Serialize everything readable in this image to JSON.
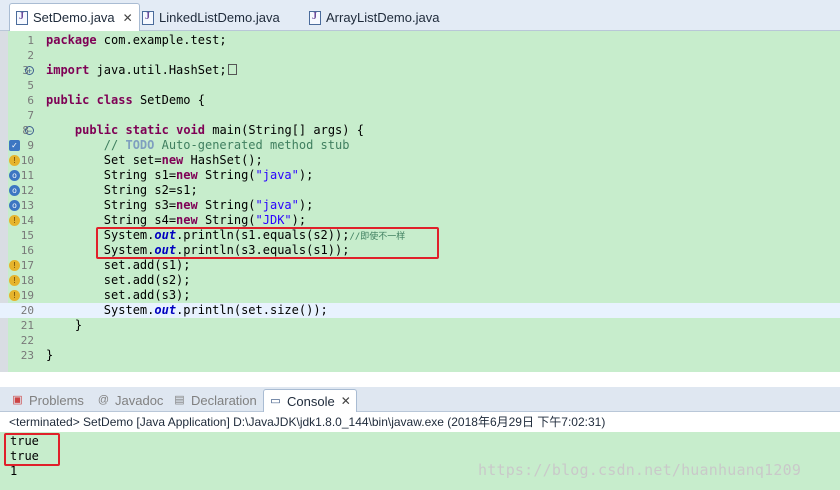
{
  "editor_tabs": [
    {
      "label": "SetDemo.java",
      "active": true
    },
    {
      "label": "LinkedListDemo.java",
      "active": false
    },
    {
      "label": "ArrayListDemo.java",
      "active": false
    }
  ],
  "close_glyph": "✕",
  "line_numbers": [
    "1",
    "2",
    "3",
    "5",
    "6",
    "7",
    "8",
    "9",
    "10",
    "11",
    "12",
    "13",
    "14",
    "15",
    "16",
    "17",
    "18",
    "19",
    "20",
    "21",
    "22",
    "23"
  ],
  "code": {
    "l1_kw": "package",
    "l1_rest": " com.example.test;",
    "l3_kw": "import",
    "l3_rest": " java.util.HashSet;",
    "l6_kw1": "public",
    "l6_kw2": "class",
    "l6_rest": " SetDemo {",
    "l8_kw1": "public",
    "l8_kw2": "static",
    "l8_kw3": "void",
    "l8_rest": " main(String[] args) {",
    "l9_cmt1": "// ",
    "l9_todo": "TODO",
    "l9_cmt2": " Auto-generated method stub",
    "l10_a": "Set set=",
    "l10_kw": "new",
    "l10_b": " HashSet();",
    "l11_a": "String s1=",
    "l11_kw": "new",
    "l11_b": " String(",
    "l11_str": "\"java\"",
    "l11_c": ");",
    "l12_a": "String s2=s1;",
    "l13_a": "String s3=",
    "l13_kw": "new",
    "l13_b": " String(",
    "l13_str": "\"java\"",
    "l13_c": ");",
    "l14_a": "String s4=",
    "l14_kw": "new",
    "l14_b": " String(",
    "l14_str": "\"JDK\"",
    "l14_c": ");",
    "l15_a": "System.",
    "l15_fld": "out",
    "l15_b": ".println(s1.equals(s2));",
    "l15_cmt": "//即使不一样",
    "l16_a": "System.",
    "l16_fld": "out",
    "l16_b": ".println(s3.equals(s1));",
    "l17_a": "set.add(s1);",
    "l18_a": "set.add(s2);",
    "l19_a": "set.add(s3);",
    "l20_a": "System.",
    "l20_fld": "out",
    "l20_b": ".println(set.size());",
    "l21_a": "}",
    "l23_a": "}"
  },
  "panel_tabs": [
    {
      "label": "Problems",
      "active": false
    },
    {
      "label": "Javadoc",
      "active": false
    },
    {
      "label": "Declaration",
      "active": false
    },
    {
      "label": "Console",
      "active": true
    }
  ],
  "console_status": "<terminated> SetDemo [Java Application] D:\\JavaJDK\\jdk1.8.0_144\\bin\\javaw.exe (2018年6月29日 下午7:02:31)",
  "console_output": [
    "true",
    "true",
    "1"
  ],
  "watermark": "https://blog.csdn.net/huanhuanq1209",
  "colors": {
    "editor_bg": "#c7edcc",
    "keyword": "#7f0055",
    "string": "#2a00ff",
    "comment": "#3f7f5f",
    "field": "#0000c0",
    "highlight_box": "#e0202a"
  }
}
